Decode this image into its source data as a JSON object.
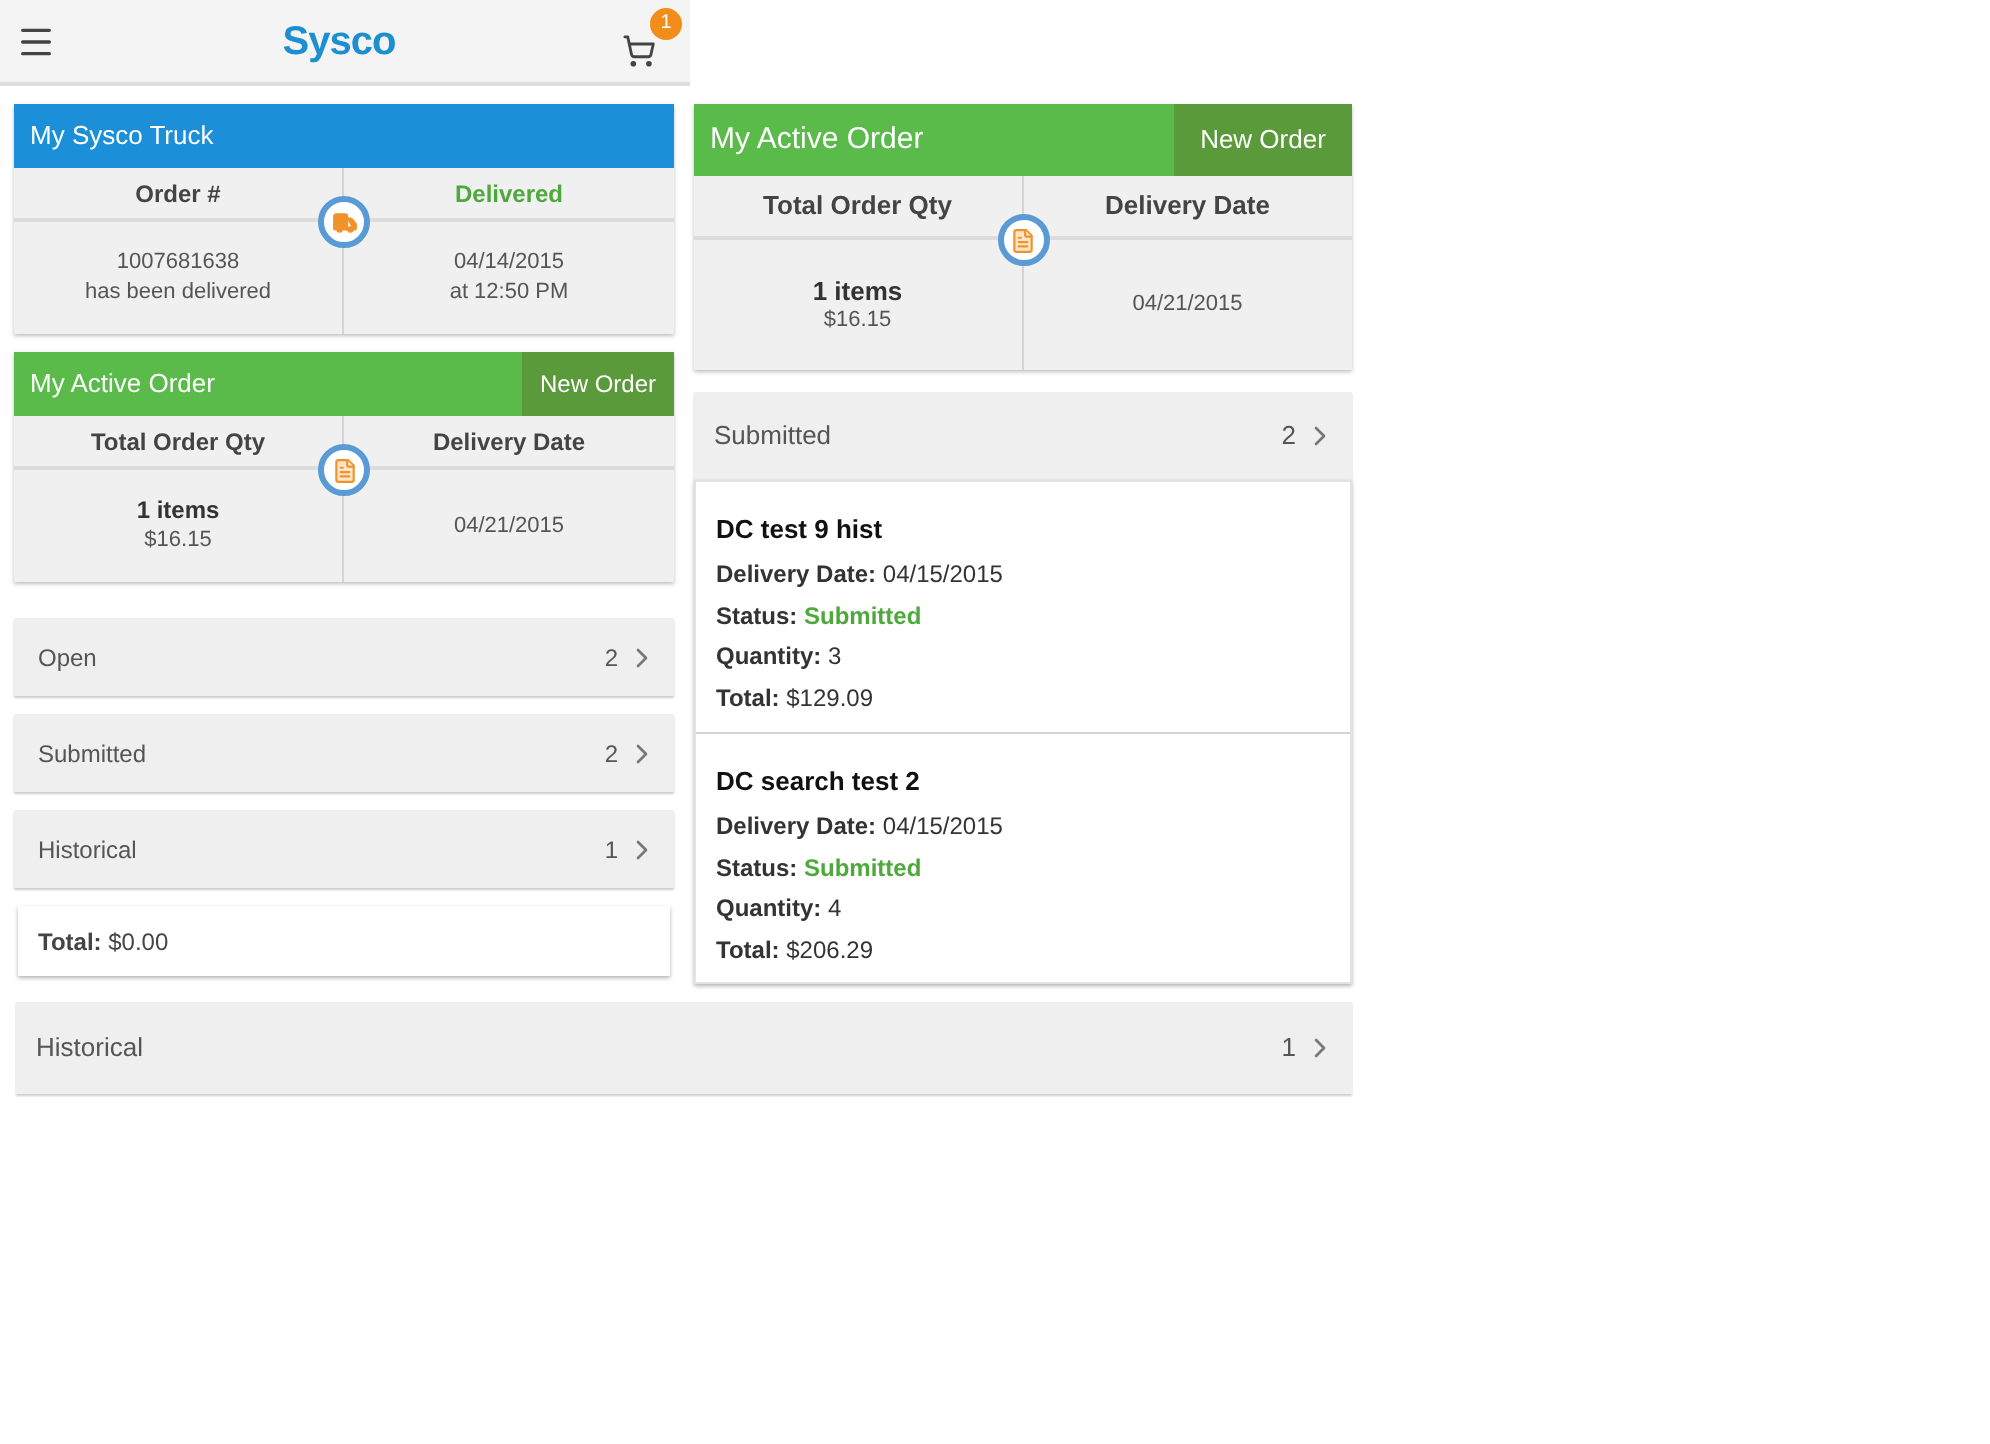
{
  "header": {
    "logo": "Sysco",
    "cart_count": "1"
  },
  "truck_card": {
    "title": "My Sysco Truck",
    "columns": [
      {
        "heading": "Order #",
        "highlight": false,
        "lines": [
          {
            "text": "1007681638",
            "bold": false
          },
          {
            "text": "has been delivered",
            "bold": false
          }
        ]
      },
      {
        "heading": "Delivered",
        "highlight": true,
        "lines": [
          {
            "text": "04/14/2015",
            "bold": false
          },
          {
            "text": "at 12:50 PM",
            "bold": false
          }
        ]
      }
    ]
  },
  "active_order_small": {
    "title": "My Active Order",
    "button": "New Order",
    "columns": [
      {
        "heading": "Total Order Qty",
        "highlight": false,
        "lines": [
          {
            "text": "1 items",
            "bold": true
          },
          {
            "text": "$16.15",
            "bold": false
          }
        ]
      },
      {
        "heading": "Delivery Date",
        "highlight": false,
        "lines": [
          {
            "text": "04/21/2015",
            "bold": false
          }
        ]
      }
    ]
  },
  "order_groups": [
    {
      "label": "Open",
      "count": "2"
    },
    {
      "label": "Submitted",
      "count": "2"
    },
    {
      "label": "Historical",
      "count": "1"
    }
  ],
  "total": "**Total:** $0.00",
  "active_order_large": {
    "title": "My Active Order",
    "button": "New Order",
    "columns": [
      {
        "heading": "Total Order Qty",
        "highlight": false,
        "lines": [
          {
            "text": "1 items",
            "bold": true
          },
          {
            "text": "$16.15",
            "bold": false
          }
        ]
      },
      {
        "heading": "Delivery Date",
        "highlight": false,
        "lines": [
          {
            "text": "04/21/2015",
            "bold": false
          }
        ]
      }
    ]
  },
  "submitted_group": {
    "label": "Submitted",
    "count": "2"
  },
  "orders": [
    {
      "name": "DC test 9 hist",
      "fields": [
        {
          "label": "Delivery Date:",
          "value": "04/15/2015",
          "highlight": false
        },
        {
          "label": "Status:",
          "value": "Submitted",
          "highlight": true
        },
        {
          "label": "Quantity:",
          "value": "3",
          "highlight": false
        },
        {
          "label": "Total:",
          "value": "$129.09",
          "highlight": false
        }
      ]
    },
    {
      "name": "DC search test 2",
      "fields": [
        {
          "label": "Delivery Date:",
          "value": "04/15/2015",
          "highlight": false
        },
        {
          "label": "Status:",
          "value": "Submitted",
          "highlight": true
        },
        {
          "label": "Quantity:",
          "value": "4",
          "highlight": false
        },
        {
          "label": "Total:",
          "value": "$206.29",
          "highlight": false
        }
      ]
    }
  ],
  "historical_group": {
    "label": "Historical",
    "count": "1"
  }
}
